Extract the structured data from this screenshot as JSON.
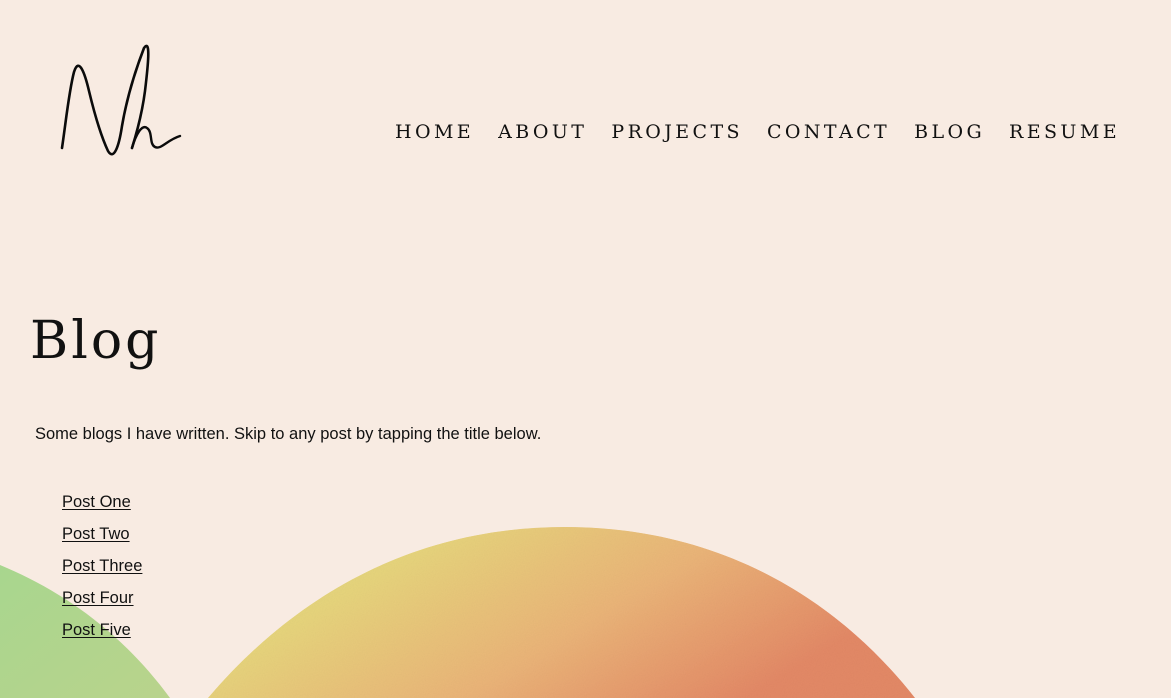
{
  "logo": {
    "icon": "signature-logo-icon"
  },
  "nav": {
    "items": [
      {
        "label": "HOME"
      },
      {
        "label": "ABOUT"
      },
      {
        "label": "PROJECTS"
      },
      {
        "label": "CONTACT"
      },
      {
        "label": "BLOG"
      },
      {
        "label": "RESUME"
      }
    ]
  },
  "main": {
    "title": "Blog",
    "intro": "Some blogs I have written. Skip to any post by tapping the title below.",
    "posts": [
      {
        "label": "Post One"
      },
      {
        "label": "Post Two"
      },
      {
        "label": "Post Three"
      },
      {
        "label": "Post Four"
      },
      {
        "label": "Post Five"
      }
    ]
  },
  "colors": {
    "background": "#f8ebe2",
    "text": "#111111",
    "green_shape": "#a9cf8c",
    "gold_shape": "#e3d07a",
    "orange_shape": "#e79a6c"
  }
}
